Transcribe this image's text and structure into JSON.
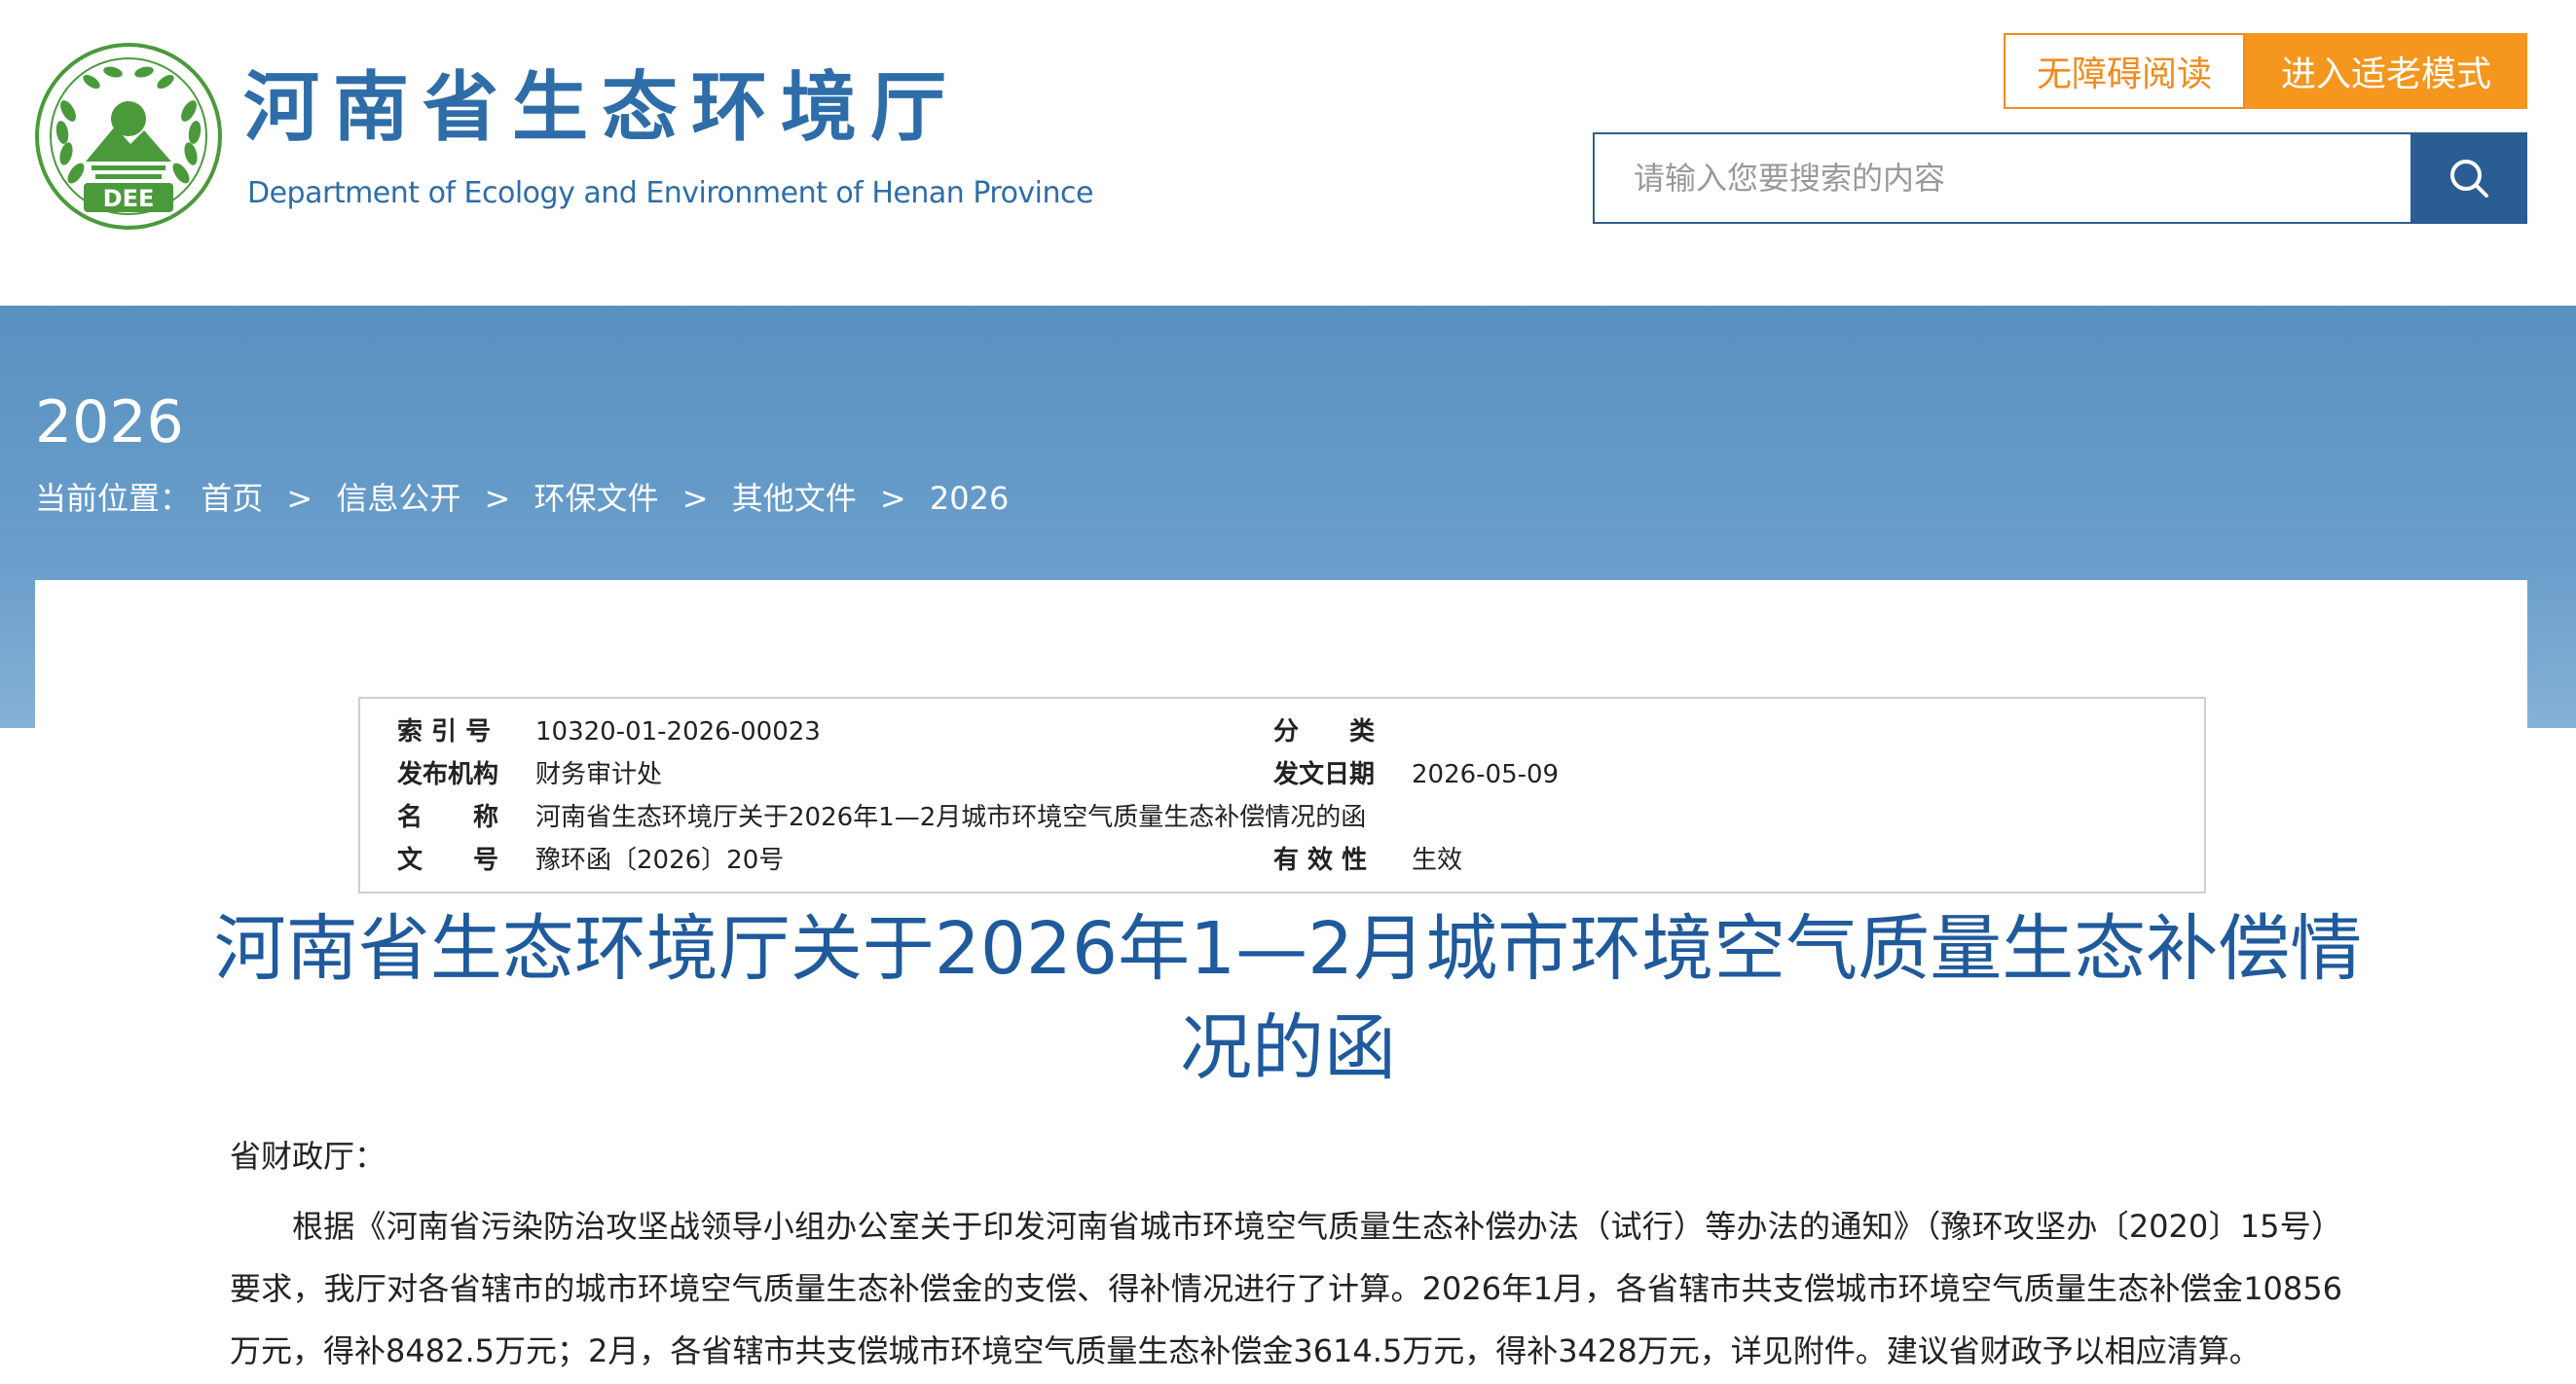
{
  "header": {
    "logo_text": "DEE",
    "site_title": "河南省生态环境厅",
    "site_subtitle": "Department of Ecology and Environment of Henan Province",
    "accessibility_button": "无障碍阅读",
    "elder_mode_button": "进入适老模式",
    "search_placeholder": "请输入您要搜索的内容",
    "search_icon": "search-icon"
  },
  "banner": {
    "title": "2026",
    "breadcrumb": {
      "prefix": "当前位置：",
      "items": [
        "首页",
        "信息公开",
        "环保文件",
        "其他文件",
        "2026"
      ],
      "separator": ">"
    }
  },
  "meta": {
    "index_label": "索 引 号",
    "index_value": "10320-01-2026-00023",
    "category_label": "分　　类",
    "category_value": "",
    "publisher_label": "发布机构",
    "publisher_value": "财务审计处",
    "date_label": "发文日期",
    "date_value": "2026-05-09",
    "name_label": "名　　称",
    "name_value": "河南省生态环境厅关于2026年1—2月城市环境空气质量生态补偿情况的函",
    "docno_label": "文　　号",
    "docno_value": "豫环函〔2026〕20号",
    "validity_label": "有 效 性",
    "validity_value": "生效"
  },
  "document": {
    "title": "河南省生态环境厅关于2026年1—2月城市环境空气质量生态补偿情况的函",
    "addressee": "省财政厅：",
    "paragraph": "根据《河南省污染防治攻坚战领导小组办公室关于印发河南省城市环境空气质量生态补偿办法（试行）等办法的通知》（豫环攻坚办〔2020〕15号）要求，我厅对各省辖市的城市环境空气质量生态补偿金的支偿、得补情况进行了计算。2026年1月，各省辖市共支偿城市环境空气质量生态补偿金10856万元，得补8482.5万元；2月，各省辖市共支偿城市环境空气质量生态补偿金3614.5万元，得补3428万元，详见附件。建议省财政予以相应清算。"
  },
  "colors": {
    "brand_blue": "#2e6da8",
    "title_blue": "#1f5a9c",
    "accent_orange": "#f5961e",
    "search_button": "#2a5d93",
    "banner_blue": "#5891c0"
  }
}
